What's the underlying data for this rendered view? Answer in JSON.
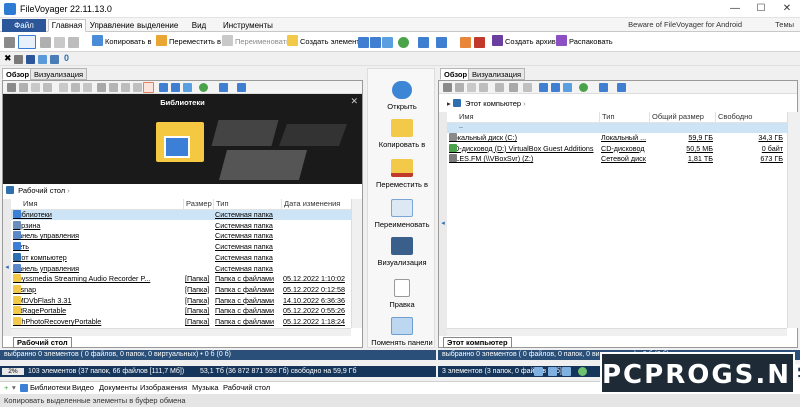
{
  "window": {
    "title": "FileVoyager 22.11.13.0",
    "minimize": "—",
    "maximize": "☐",
    "close": "✕"
  },
  "ribbon_tabs": [
    "Файл",
    "Главная",
    "Управление",
    "выделение",
    "Вид",
    "Инструменты"
  ],
  "ribbon_right": {
    "beware": "Beware of FileVoyager for Android",
    "themes": "Темы"
  },
  "toolbar": {
    "copy_to": "Копировать в",
    "move_to": "Переместить в",
    "rename": "Переименовать",
    "create_element": "Создать элемент",
    "create_archive": "Создать архив",
    "extract": "Распаковать"
  },
  "toolbar2": {
    "number": "0"
  },
  "left_pane": {
    "tabs": [
      "Обзор",
      "Визуализация"
    ],
    "preview_title": "Библиотеки",
    "breadcrumb": "Рабочий стол",
    "columns": [
      "Имя",
      "Размер",
      "Тип",
      "Дата изменения"
    ],
    "rows": [
      {
        "name": "Библиотеки",
        "size": "",
        "type": "Системная папка",
        "date": "",
        "icon": "library-icon",
        "selected": true
      },
      {
        "name": "Корзина",
        "size": "",
        "type": "Системная папка",
        "date": "",
        "icon": "recycle-bin-icon"
      },
      {
        "name": "Панель управления",
        "size": "",
        "type": "Системная папка",
        "date": "",
        "icon": "control-panel-icon"
      },
      {
        "name": "Сеть",
        "size": "",
        "type": "Системная папка",
        "date": "",
        "icon": "network-icon"
      },
      {
        "name": "Этот компьютер",
        "size": "",
        "type": "Системная папка",
        "date": "",
        "icon": "computer-icon"
      },
      {
        "name": "Панель управления",
        "size": "",
        "type": "Системная папка",
        "date": "",
        "icon": "control-panel-icon"
      },
      {
        "name": "Abyssmedia Streaming Audio Recorder P...",
        "size": "[Папка]",
        "type": "Папка с файлами",
        "date": "05.12.2022 1:10:02",
        "icon": "folder-icon"
      },
      {
        "name": "altsnap",
        "size": "[Папка]",
        "type": "Папка с файлами",
        "date": "05.12.2022 0:12:58",
        "icon": "folder-icon"
      },
      {
        "name": "AMDVbFlash 3.31",
        "size": "[Папка]",
        "type": "Папка с файлами",
        "date": "14.10.2022 6:36:36",
        "icon": "folder-icon"
      },
      {
        "name": "ArtRagePortable",
        "size": "[Папка]",
        "type": "Папка с файлами",
        "date": "05.12.2022 0:55:26",
        "icon": "folder-icon"
      },
      {
        "name": "AshPhotoRecoveryPortable",
        "size": "[Папка]",
        "type": "Папка с файлами",
        "date": "05.12.2022 1:18:24",
        "icon": "folder-icon"
      }
    ],
    "bottom_tab": "Рабочий стол",
    "status": "выбранно 0 элементов ( 0 файлов, 0 папок, 0 виртуальных) • 0 б (0 б)",
    "drive_percent": "2%",
    "drive_info": "103 элементов (37 папок, 66 файлов [111,7 Мб])",
    "drive_free": "53,1 Тб (36 872 871 593 Гб) свободно на 59,9 Гб"
  },
  "center_buttons": [
    "Открыть",
    "Копировать в",
    "Переместить в",
    "Переименовать",
    "Визуализация",
    "Правка",
    "Поменять панели"
  ],
  "right_pane": {
    "tabs": [
      "Обзор",
      "Визуализация"
    ],
    "breadcrumb": "Этот компьютер",
    "columns": [
      "Имя",
      "Тип",
      "Общий размер",
      "Свободно"
    ],
    "rows": [
      {
        "name": "Локальный диск (C:)",
        "type": "Локальный ...",
        "total": "59,9 ГБ",
        "free": "34,3 ГБ",
        "icon": "hdd-icon"
      },
      {
        "name": "CD-дисковод (D:) VirtualBox Guest Additions",
        "type": "CD-дисковод",
        "total": "50,5 МБ",
        "free": "0 байт",
        "icon": "cd-icon"
      },
      {
        "name": "FILES.FM (\\\\VBoxSvr) (Z:)",
        "type": "Сетевой диск",
        "total": "1,81 ТБ",
        "free": "673 ГБ",
        "icon": "network-drive-icon"
      }
    ],
    "bottom_tab": "Этот компьютер",
    "status": "выбранно 0 элементов ( 0 файлов, 0 папок, 0 виртуальных) • 0 б (0 б)",
    "drive_info": "3 элементов (3 папок, 0 файлов [0 б])"
  },
  "favorites": [
    "Библиотеки",
    "Видео",
    "Документы",
    "Изображения",
    "Музыка",
    "Рабочий стол"
  ],
  "bottom_status": "Копировать выделенные элементы в буфер обмена",
  "watermark": "PCPROGS.NET",
  "colors": {
    "accent": "#2b579a",
    "status": "#2a4f78",
    "selection": "#cde4f7"
  }
}
